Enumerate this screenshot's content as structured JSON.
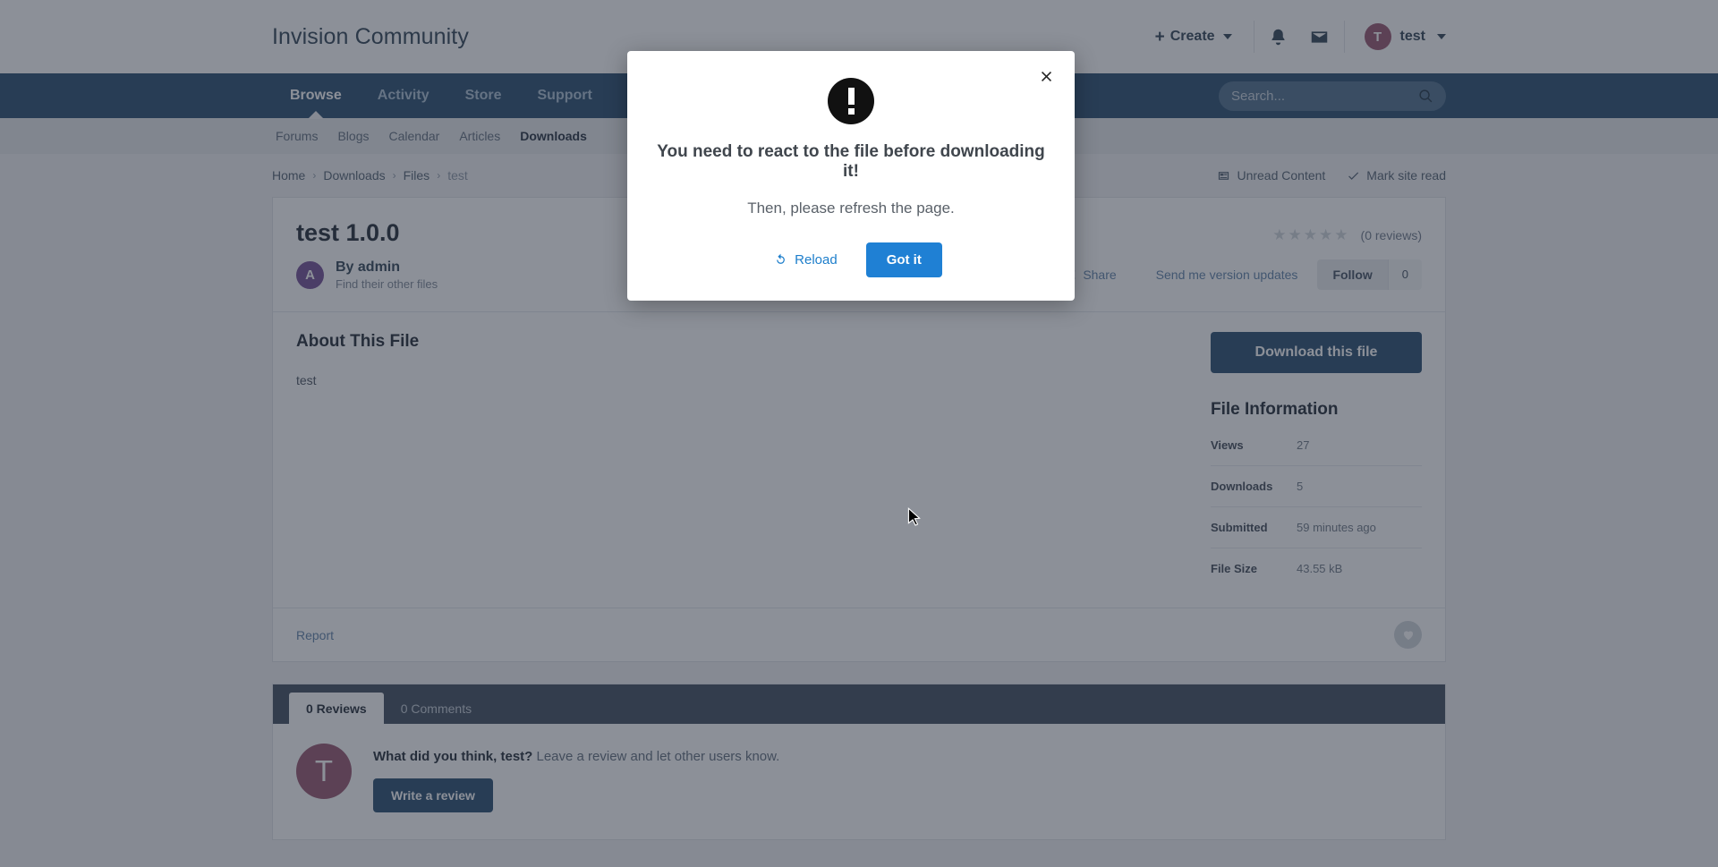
{
  "header": {
    "brand": "Invision Community",
    "create_label": "Create",
    "notifications_icon": "bell-icon",
    "messages_icon": "envelope-icon",
    "user_initial": "T",
    "user_name": "test"
  },
  "primary_nav": {
    "items": [
      {
        "label": "Browse",
        "active": true
      },
      {
        "label": "Activity",
        "active": false
      },
      {
        "label": "Store",
        "active": false
      },
      {
        "label": "Support",
        "active": false
      }
    ]
  },
  "search": {
    "placeholder": "Search...",
    "value": "",
    "icon": "search-icon"
  },
  "secondary_nav": {
    "items": [
      {
        "label": "Forums",
        "active": false
      },
      {
        "label": "Blogs",
        "active": false
      },
      {
        "label": "Calendar",
        "active": false
      },
      {
        "label": "Articles",
        "active": false
      },
      {
        "label": "Downloads",
        "active": true
      }
    ]
  },
  "breadcrumb": {
    "items": [
      "Home",
      "Downloads",
      "Files",
      "test"
    ],
    "separator": "›",
    "unread_label": "Unread Content",
    "mark_read_label": "Mark site read"
  },
  "file": {
    "title": "test 1.0.0",
    "stars": 5,
    "filled_stars": 0,
    "reviews_label": "(0 reviews)",
    "author_initial": "A",
    "author_line": "By admin",
    "author_sub": "Find their other files",
    "share_label": "Share",
    "version_updates_label": "Send me version updates",
    "follow_label": "Follow",
    "follow_count": "0",
    "about_heading": "About This File",
    "about_text": "test",
    "report_label": "Report",
    "like_icon": "heart-icon"
  },
  "sidebar": {
    "download_label": "Download this file",
    "info_heading": "File Information",
    "rows": [
      {
        "label": "Views",
        "value": "27"
      },
      {
        "label": "Downloads",
        "value": "5"
      },
      {
        "label": "Submitted",
        "value": "59 minutes ago"
      },
      {
        "label": "File Size",
        "value": "43.55 kB"
      }
    ]
  },
  "reviews": {
    "tabs": [
      {
        "label": "0 Reviews",
        "active": true
      },
      {
        "label": "0 Comments",
        "active": false
      }
    ],
    "avatar_initial": "T",
    "prompt_bold": "What did you think, test?",
    "prompt_rest": " Leave a review and let other users know.",
    "write_label": "Write a review"
  },
  "modal": {
    "icon": "exclamation-icon",
    "title": "You need to react to the file before downloading it!",
    "subtitle": "Then, please refresh the page.",
    "reload_label": "Reload",
    "confirm_label": "Got it",
    "close_icon": "close-icon"
  },
  "colors": {
    "nav_blue": "#22486b",
    "primary_button": "#1f80d4",
    "link_blue": "#1d7ecb",
    "avatar_purple": "#6f4a93",
    "avatar_mauve": "#96516b"
  }
}
